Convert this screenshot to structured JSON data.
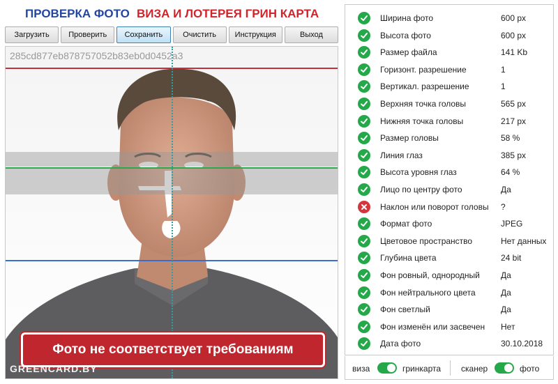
{
  "header": {
    "title_left": "ПРОВЕРКА ФОТО",
    "title_right": "ВИЗА И ЛОТЕРЕЯ ГРИН КАРТА"
  },
  "toolbar": {
    "buttons": [
      "Загрузить",
      "Проверить",
      "Сохранить",
      "Очистить",
      "Инструкция",
      "Выход"
    ],
    "active_button": "Сохранить"
  },
  "photo": {
    "hash": "285cd877eb878757052b83eb0d0452a3",
    "verdict": "Фото не соответствует требованиям",
    "watermark": "GREENCARD.BY"
  },
  "results": [
    {
      "label": "Ширина фото",
      "value": "600 px",
      "ok": true
    },
    {
      "label": "Высота фото",
      "value": "600 px",
      "ok": true
    },
    {
      "label": "Размер файла",
      "value": "141 Kb",
      "ok": true
    },
    {
      "label": "Горизонт. разрешение",
      "value": "1",
      "ok": true
    },
    {
      "label": "Вертикал. разрешение",
      "value": "1",
      "ok": true
    },
    {
      "label": "Верхняя точка головы",
      "value": "565 px",
      "ok": true
    },
    {
      "label": "Нижняя точка головы",
      "value": "217 px",
      "ok": true
    },
    {
      "label": "Размер головы",
      "value": "58 %",
      "ok": true
    },
    {
      "label": "Линия глаз",
      "value": "385 px",
      "ok": true
    },
    {
      "label": "Высота уровня глаз",
      "value": "64 %",
      "ok": true
    },
    {
      "label": "Лицо по центру фото",
      "value": "Да",
      "ok": true
    },
    {
      "label": "Наклон или поворот головы",
      "value": "?",
      "ok": false
    },
    {
      "label": "Формат фото",
      "value": "JPEG",
      "ok": true
    },
    {
      "label": "Цветовое пространство",
      "value": "Нет данных",
      "ok": true
    },
    {
      "label": "Глубина цвета",
      "value": "24 bit",
      "ok": true
    },
    {
      "label": "Фон ровный, однородный",
      "value": "Да",
      "ok": true
    },
    {
      "label": "Фон нейтрального цвета",
      "value": "Да",
      "ok": true
    },
    {
      "label": "Фон светлый",
      "value": "Да",
      "ok": true
    },
    {
      "label": "Фон изменён или засвечен",
      "value": "Нет",
      "ok": true
    },
    {
      "label": "Дата фото",
      "value": "30.10.2018",
      "ok": true
    }
  ],
  "toggles": {
    "left_off": "виза",
    "left_on": "гринкарта",
    "right_off": "сканер",
    "right_on": "фото"
  },
  "colors": {
    "ok": "#25a84a",
    "bad": "#d6353c",
    "title_blue": "#2346a0",
    "title_red": "#d2232a"
  }
}
